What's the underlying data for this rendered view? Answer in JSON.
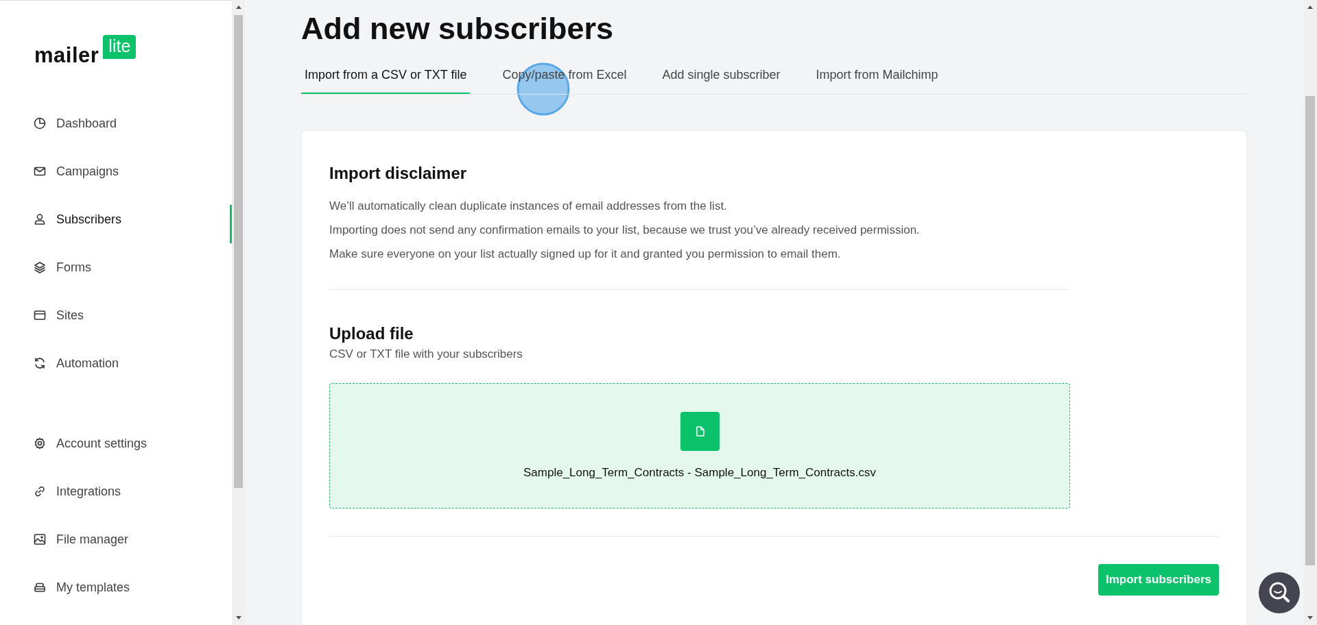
{
  "logo": {
    "word": "mailer",
    "badge": "lite"
  },
  "sidebar": {
    "items": [
      {
        "label": "Dashboard",
        "selected": false
      },
      {
        "label": "Campaigns",
        "selected": false
      },
      {
        "label": "Subscribers",
        "selected": true
      },
      {
        "label": "Forms",
        "selected": false
      },
      {
        "label": "Sites",
        "selected": false
      },
      {
        "label": "Automation",
        "selected": false
      }
    ],
    "bottom_items": [
      {
        "label": "Account settings",
        "selected": false
      },
      {
        "label": "Integrations",
        "selected": false
      },
      {
        "label": "File manager",
        "selected": false
      },
      {
        "label": "My templates",
        "selected": false
      }
    ]
  },
  "page": {
    "title": "Add new subscribers",
    "tabs": [
      {
        "label": "Import from a CSV or TXT file",
        "selected": true
      },
      {
        "label": "Copy/paste from Excel",
        "selected": false
      },
      {
        "label": "Add single subscriber",
        "selected": false
      },
      {
        "label": "Import from Mailchimp",
        "selected": false
      }
    ],
    "disclaimer": {
      "heading": "Import disclaimer",
      "lines": [
        "We’ll automatically clean duplicate instances of email addresses from the list.",
        "Importing does not send any confirmation emails to your list, because we trust you’ve already received permission.",
        "Make sure everyone on your list actually signed up for it and granted you permission to email them."
      ]
    },
    "upload": {
      "heading": "Upload file",
      "subtitle": "CSV or TXT file with your subscribers",
      "file_name": "Sample_Long_Term_Contracts - Sample_Long_Term_Contracts.csv"
    },
    "submit": "Import subscribers"
  }
}
